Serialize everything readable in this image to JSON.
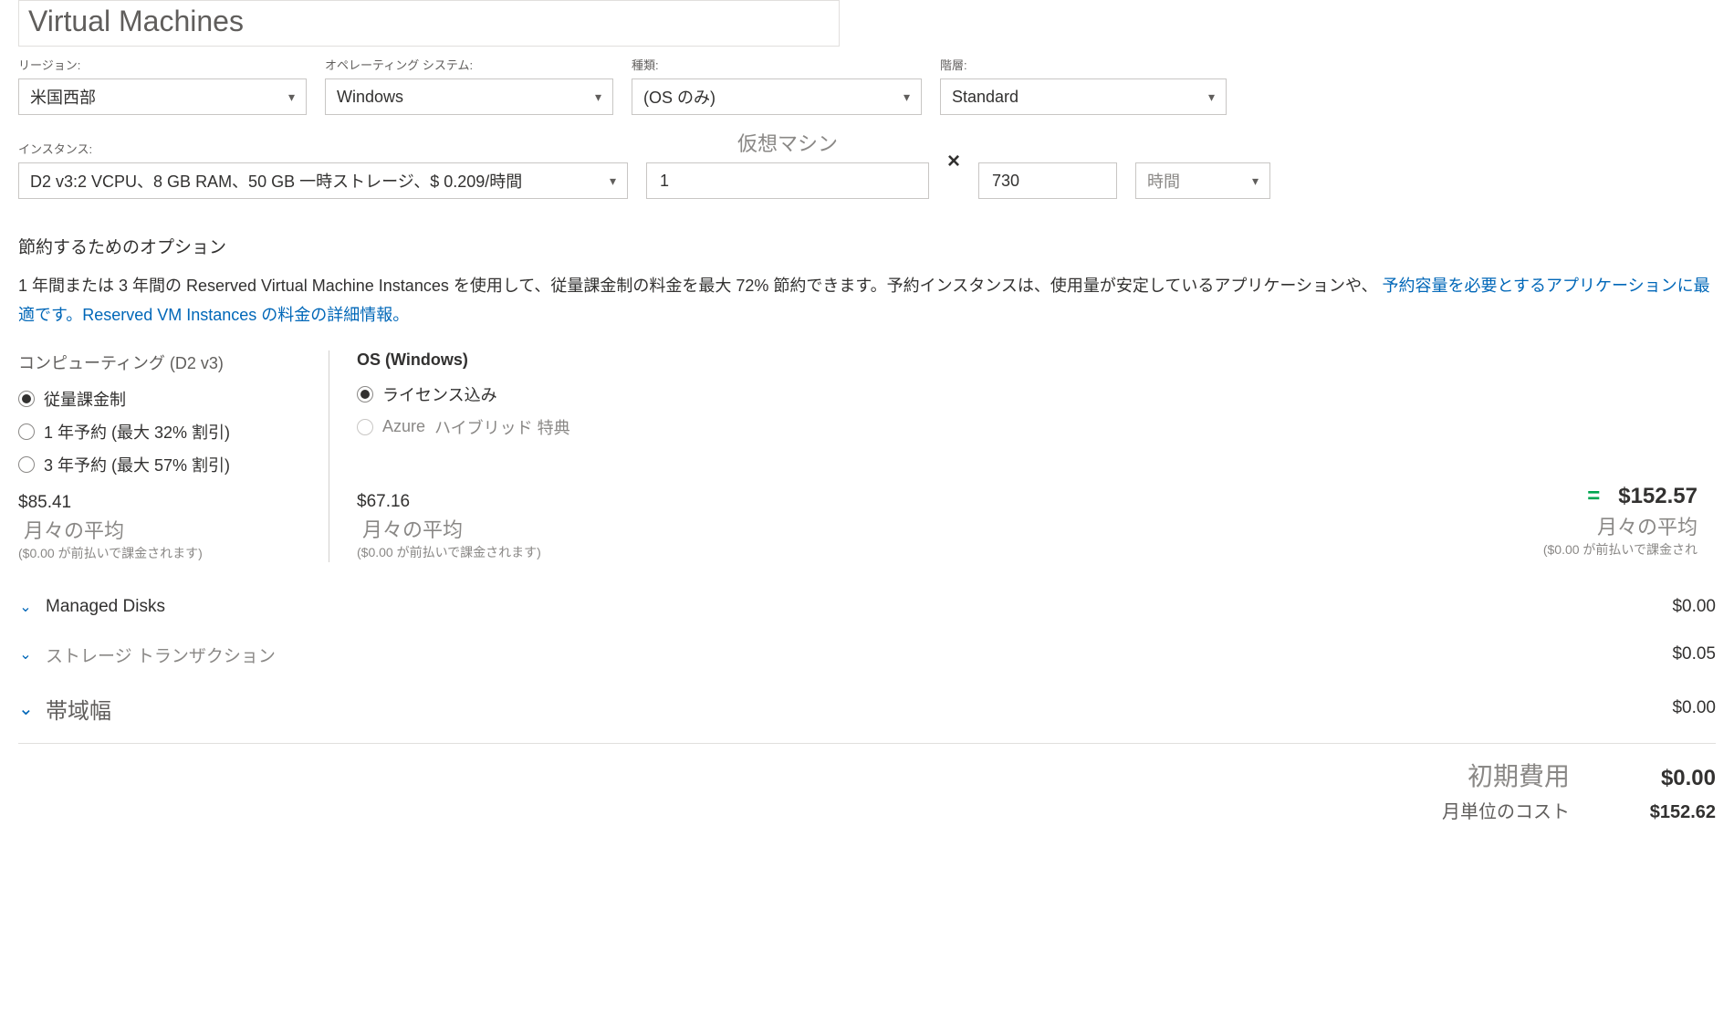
{
  "title": "Virtual Machines",
  "fields": {
    "region": {
      "label": "リージョン:",
      "value": "米国西部"
    },
    "os": {
      "label": "オペレーティング システム:",
      "value": "Windows"
    },
    "type": {
      "label": "種類:",
      "value": "(OS のみ)"
    },
    "tier": {
      "label": "階層:",
      "value": "Standard"
    },
    "instance": {
      "label": "インスタンス:",
      "value": "D2 v3:2 VCPU、8 GB RAM、50 GB 一時ストレージ、$ 0.209/時間"
    },
    "vm_heading": "仮想マシン",
    "count": "1",
    "times": "×",
    "hours": "730",
    "unit": "時間"
  },
  "savings": {
    "heading": "節約するためのオプション",
    "desc_before": "1 年間または 3 年間の Reserved Virtual Machine Instances を使用して、従量課金制の料金を最大 72% 節約できます。予約インスタンスは、使用量が安定しているアプリケーションや、",
    "desc_link": "予約容量を必要とするアプリケーションに最適です。Reserved VM Instances の料金の詳細情報。",
    "compute": {
      "title": "コンピューティング (D2 v3)",
      "options": {
        "payg": "従量課金制",
        "y1": "1 年予約 (最大 32% 割引)",
        "y3": "3 年予約 (最大 57% 割引)"
      },
      "price": "$85.41",
      "avg": "月々の平均",
      "upfront": "($0.00 が前払いで課金されます)"
    },
    "oscol": {
      "title": "OS (Windows)",
      "options": {
        "included": "ライセンス込み",
        "hybrid_a": "Azure ",
        "hybrid_b": "ハイブリッド 特典"
      },
      "price": "$67.16",
      "avg": "月々の平均",
      "upfront": "($0.00 が前払いで課金されます)"
    },
    "total": {
      "eq": "=",
      "price": "$152.57",
      "avg": "月々の平均",
      "upfront": "($0.00 が前払いで課金され"
    }
  },
  "accordion": {
    "disks": {
      "title": "Managed Disks",
      "amount": "$0.00"
    },
    "storage": {
      "title": "ストレージ トランザクション",
      "amount": "$0.05"
    },
    "bw": {
      "title": "帯域幅",
      "amount": "$0.00"
    }
  },
  "totals": {
    "initial": {
      "label": "初期費用",
      "value": "$0.00"
    },
    "monthly": {
      "label": "月単位のコスト",
      "value": "$152.62"
    }
  }
}
